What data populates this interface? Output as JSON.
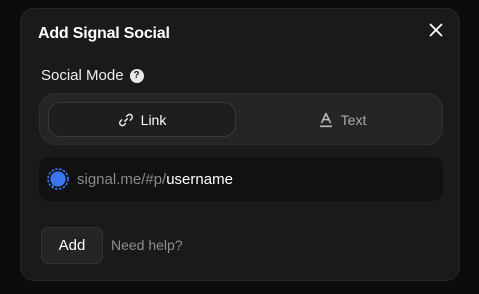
{
  "dialog": {
    "title": "Add Signal Social",
    "close_icon": "close-icon"
  },
  "social_mode": {
    "label": "Social Mode",
    "help_icon": "question-icon",
    "help_glyph": "?",
    "options": [
      {
        "label": "Link",
        "icon": "link-icon",
        "active": true
      },
      {
        "label": "Text",
        "icon": "text-icon",
        "active": false
      }
    ]
  },
  "url_field": {
    "icon": "signal-icon",
    "prefix": "signal.me/#p/",
    "value": "username"
  },
  "actions": {
    "add_label": "Add",
    "help_label": "Need help?"
  },
  "colors": {
    "background": "#0c0c0c",
    "dialog": "#1a1a1a",
    "signal_blue": "#3a76f0"
  }
}
